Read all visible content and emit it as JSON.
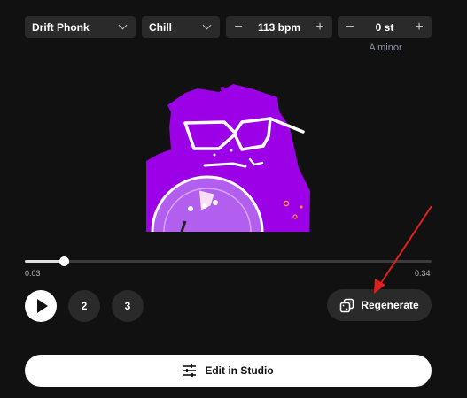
{
  "controls": {
    "genre": {
      "value": "Drift Phonk"
    },
    "mood": {
      "value": "Chill"
    },
    "tempo": {
      "value": "113",
      "unit": "bpm",
      "minus": "−",
      "plus": "+"
    },
    "transpose": {
      "value": "0 st",
      "minus": "−",
      "plus": "+"
    },
    "key_label": "A minor"
  },
  "player": {
    "elapsed": "0:03",
    "duration": "0:34",
    "progress": 0.0959,
    "variations": [
      "2",
      "3"
    ],
    "regenerate_label": "Regenerate",
    "edit_label": "Edit in Studio"
  },
  "colors": {
    "art": "#9b00e6",
    "background": "#111111",
    "annotation_arrow": "#e02020"
  },
  "icons": [
    "chevron-down-icon",
    "minus-icon",
    "plus-icon",
    "play-icon",
    "dice-icon",
    "sliders-icon"
  ]
}
